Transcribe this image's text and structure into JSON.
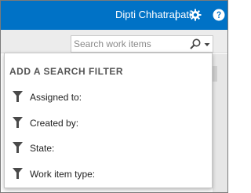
{
  "header": {
    "user_name": "Dipti Chhatrapati",
    "separator": "|",
    "settings_icon": "gear-icon",
    "help_icon": "help-icon"
  },
  "search": {
    "placeholder": "Search work items",
    "value": "",
    "search_icon": "search-icon",
    "dropdown_icon": "chevron-down-icon"
  },
  "popup": {
    "title": "ADD A SEARCH FILTER",
    "filters": [
      {
        "label": "Assigned to:",
        "icon": "funnel-icon"
      },
      {
        "label": "Created by:",
        "icon": "funnel-icon"
      },
      {
        "label": "State:",
        "icon": "funnel-icon"
      },
      {
        "label": "Work item type:",
        "icon": "funnel-icon"
      }
    ]
  },
  "colors": {
    "topbar": "#0072c6",
    "subbar": "#ececec",
    "popup_bg": "#ffffff",
    "title_text": "#555555",
    "icon_gray": "#4a4a4a"
  }
}
